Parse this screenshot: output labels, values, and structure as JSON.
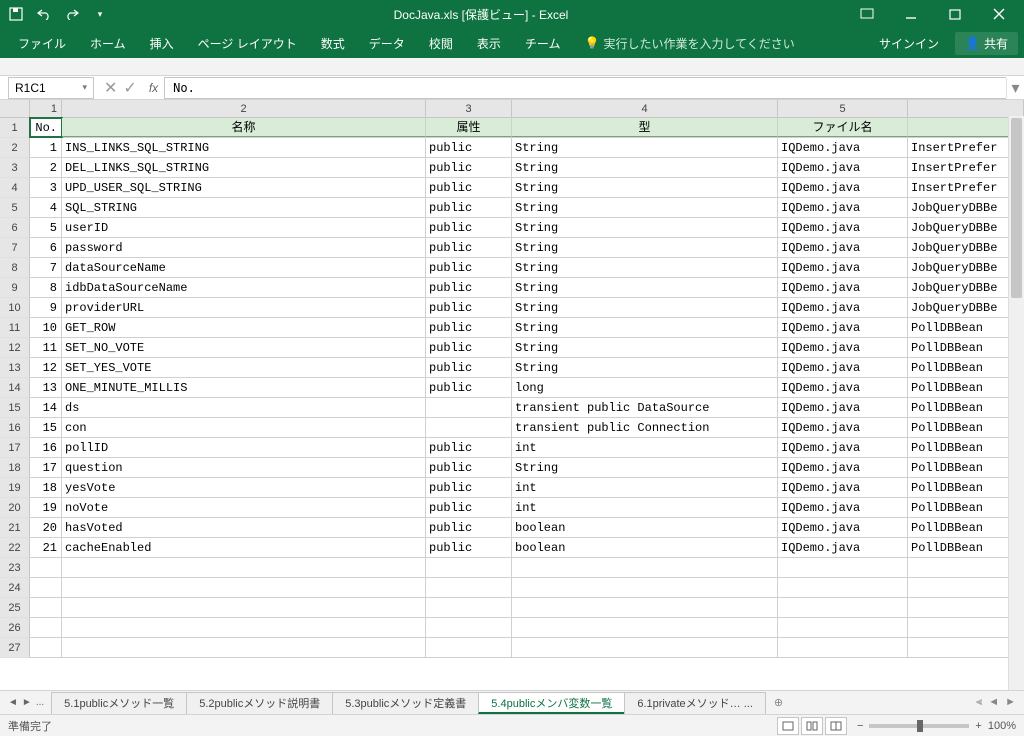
{
  "title": "DocJava.xls  [保護ビュー] - Excel",
  "qat": {
    "save": "save",
    "undo": "undo",
    "redo": "redo"
  },
  "ribbon": {
    "tabs": [
      "ファイル",
      "ホーム",
      "挿入",
      "ページ レイアウト",
      "数式",
      "データ",
      "校閲",
      "表示",
      "チーム"
    ],
    "tellme": "実行したい作業を入力してください",
    "signin": "サインイン",
    "share": "共有"
  },
  "namebox": "R1C1",
  "formula": "No.",
  "columns": {
    "c1": "1",
    "c2": "2",
    "c3": "3",
    "c4": "4",
    "c5": "5",
    "c6": ""
  },
  "headers": {
    "no": "No.",
    "name": "名称",
    "attr": "属性",
    "type": "型",
    "file": "ファイル名",
    "extra": ""
  },
  "rows": [
    {
      "n": "1",
      "name": "INS_LINKS_SQL_STRING",
      "attr": "public",
      "type": "String",
      "file": "IQDemo.java",
      "extra": "InsertPrefer"
    },
    {
      "n": "2",
      "name": "DEL_LINKS_SQL_STRING",
      "attr": "public",
      "type": "String",
      "file": "IQDemo.java",
      "extra": "InsertPrefer"
    },
    {
      "n": "3",
      "name": "UPD_USER_SQL_STRING",
      "attr": "public",
      "type": "String",
      "file": "IQDemo.java",
      "extra": "InsertPrefer"
    },
    {
      "n": "4",
      "name": "SQL_STRING",
      "attr": "public",
      "type": "String",
      "file": "IQDemo.java",
      "extra": "JobQueryDBBe"
    },
    {
      "n": "5",
      "name": "userID",
      "attr": "public",
      "type": "String",
      "file": "IQDemo.java",
      "extra": "JobQueryDBBe"
    },
    {
      "n": "6",
      "name": "password",
      "attr": "public",
      "type": "String",
      "file": "IQDemo.java",
      "extra": "JobQueryDBBe"
    },
    {
      "n": "7",
      "name": "dataSourceName",
      "attr": "public",
      "type": "String",
      "file": "IQDemo.java",
      "extra": "JobQueryDBBe"
    },
    {
      "n": "8",
      "name": "idbDataSourceName",
      "attr": "public",
      "type": "String",
      "file": "IQDemo.java",
      "extra": "JobQueryDBBe"
    },
    {
      "n": "9",
      "name": "providerURL",
      "attr": "public",
      "type": "String",
      "file": "IQDemo.java",
      "extra": "JobQueryDBBe"
    },
    {
      "n": "10",
      "name": "GET_ROW",
      "attr": "public",
      "type": "String",
      "file": "IQDemo.java",
      "extra": "PollDBBean"
    },
    {
      "n": "11",
      "name": "SET_NO_VOTE",
      "attr": "public",
      "type": "String",
      "file": "IQDemo.java",
      "extra": "PollDBBean"
    },
    {
      "n": "12",
      "name": "SET_YES_VOTE",
      "attr": "public",
      "type": "String",
      "file": "IQDemo.java",
      "extra": "PollDBBean"
    },
    {
      "n": "13",
      "name": "ONE_MINUTE_MILLIS",
      "attr": "public",
      "type": "long",
      "file": "IQDemo.java",
      "extra": "PollDBBean"
    },
    {
      "n": "14",
      "name": "ds",
      "attr": "",
      "type": "transient public DataSource",
      "file": "IQDemo.java",
      "extra": "PollDBBean"
    },
    {
      "n": "15",
      "name": "con",
      "attr": "",
      "type": "transient public Connection",
      "file": "IQDemo.java",
      "extra": "PollDBBean"
    },
    {
      "n": "16",
      "name": "pollID",
      "attr": "public",
      "type": "int",
      "file": "IQDemo.java",
      "extra": "PollDBBean"
    },
    {
      "n": "17",
      "name": "question",
      "attr": "public",
      "type": "String",
      "file": "IQDemo.java",
      "extra": "PollDBBean"
    },
    {
      "n": "18",
      "name": "yesVote",
      "attr": "public",
      "type": "int",
      "file": "IQDemo.java",
      "extra": "PollDBBean"
    },
    {
      "n": "19",
      "name": "noVote",
      "attr": "public",
      "type": "int",
      "file": "IQDemo.java",
      "extra": "PollDBBean"
    },
    {
      "n": "20",
      "name": "hasVoted",
      "attr": "public",
      "type": "boolean",
      "file": "IQDemo.java",
      "extra": "PollDBBean"
    },
    {
      "n": "21",
      "name": "cacheEnabled",
      "attr": "public",
      "type": "boolean",
      "file": "IQDemo.java",
      "extra": "PollDBBean"
    }
  ],
  "sheets": {
    "more": "...",
    "tabs": [
      "5.1publicメソッド一覧",
      "5.2publicメソッド説明書",
      "5.3publicメソッド定義書",
      "5.4publicメンバ変数一覧",
      "6.1privateメソッド… ..."
    ],
    "active_index": 3
  },
  "status": {
    "ready": "準備完了",
    "zoom": "100%"
  }
}
